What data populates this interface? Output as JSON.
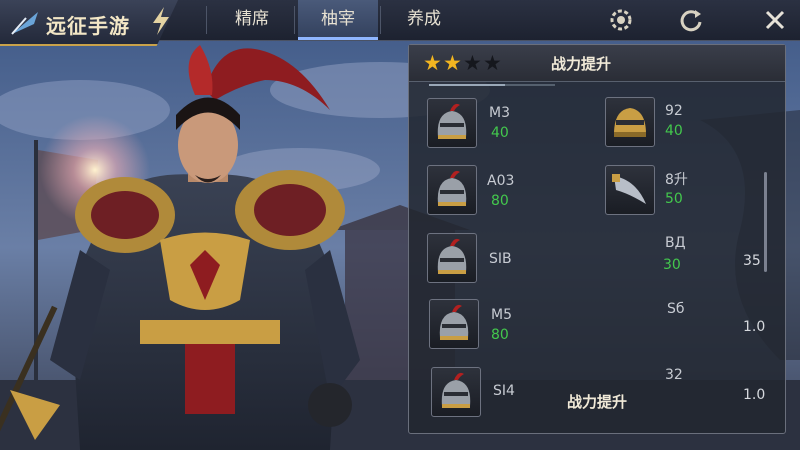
{
  "app": {
    "title": "远征手游"
  },
  "tabs": [
    {
      "label": "精席"
    },
    {
      "label": "柚宰"
    },
    {
      "label": "养成"
    }
  ],
  "top_icons": [
    "settings-gear-icon",
    "refresh-icon",
    "close-icon"
  ],
  "panel": {
    "stars_filled": 2,
    "stars_total": 4,
    "header_title": "战力提升",
    "progress": 0.6,
    "left_items": [
      {
        "code": "M3",
        "value": "40",
        "icon": "knight-helmet-icon"
      },
      {
        "code": "A03",
        "value": "80",
        "icon": "knight-helmet-icon"
      },
      {
        "code": "SIB",
        "value": "",
        "icon": "knight-helmet-icon"
      },
      {
        "code": "M5",
        "value": "80",
        "icon": "knight-helmet-icon"
      },
      {
        "code": "SI4",
        "value": "",
        "icon": "knight-helmet-icon"
      }
    ],
    "right_items": [
      {
        "code": "92",
        "value": "40",
        "icon": "golden-helmet-icon"
      },
      {
        "code": "8升",
        "value": "50",
        "icon": "curved-blade-icon"
      },
      {
        "code": "BД",
        "value": "30"
      },
      {
        "code": "Sб",
        "value": ""
      },
      {
        "code": "32",
        "value": ""
      }
    ],
    "side_values": [
      "35",
      "1.0",
      "1.0"
    ],
    "footer_label": "战力提升"
  },
  "colors": {
    "accent_gold": "#c9a24a",
    "star_gold": "#f2b521",
    "value_green": "#43c84d",
    "active_tab": "#8fb6ff"
  }
}
